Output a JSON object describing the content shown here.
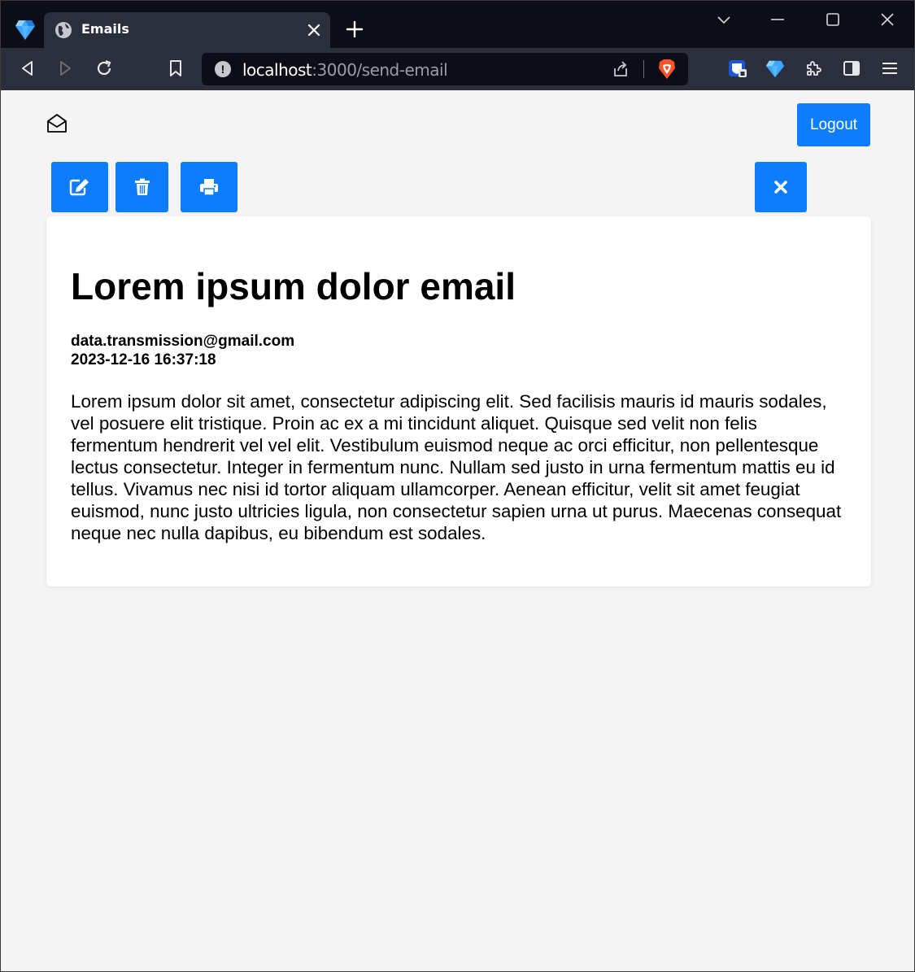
{
  "browser": {
    "tab_title": "Emails",
    "url_host": "localhost",
    "url_path": ":3000/send-email"
  },
  "header": {
    "logout_label": "Logout"
  },
  "actions": {
    "edit_icon": "edit-icon",
    "delete_icon": "trash-icon",
    "print_icon": "print-icon",
    "close_icon": "close-icon"
  },
  "email": {
    "subject": "Lorem ipsum dolor email",
    "from": "data.transmission@gmail.com",
    "date": "2023-12-16 16:37:18",
    "body": "Lorem ipsum dolor sit amet, consectetur adipiscing elit. Sed facilisis mauris id mauris sodales, vel posuere elit tristique. Proin ac ex a mi tincidunt aliquet. Quisque sed velit non felis fermentum hendrerit vel vel elit. Vestibulum euismod neque ac orci efficitur, non pellentesque lectus consectetur. Integer in fermentum nunc. Nullam sed justo in urna fermentum mattis eu id tellus. Vivamus nec nisi id tortor aliquam ullamcorper. Aenean efficitur, velit sit amet feugiat euismod, nunc justo ultricies ligula, non consectetur sapien urna ut purus. Maecenas consequat neque nec nulla dapibus, eu bibendum est sodales."
  },
  "colors": {
    "accent": "#0d7dfe",
    "page_bg": "#f4f4f4",
    "card_bg": "#ffffff",
    "chrome_dark": "#0c0d16",
    "chrome_toolbar": "#2b2f3c"
  }
}
